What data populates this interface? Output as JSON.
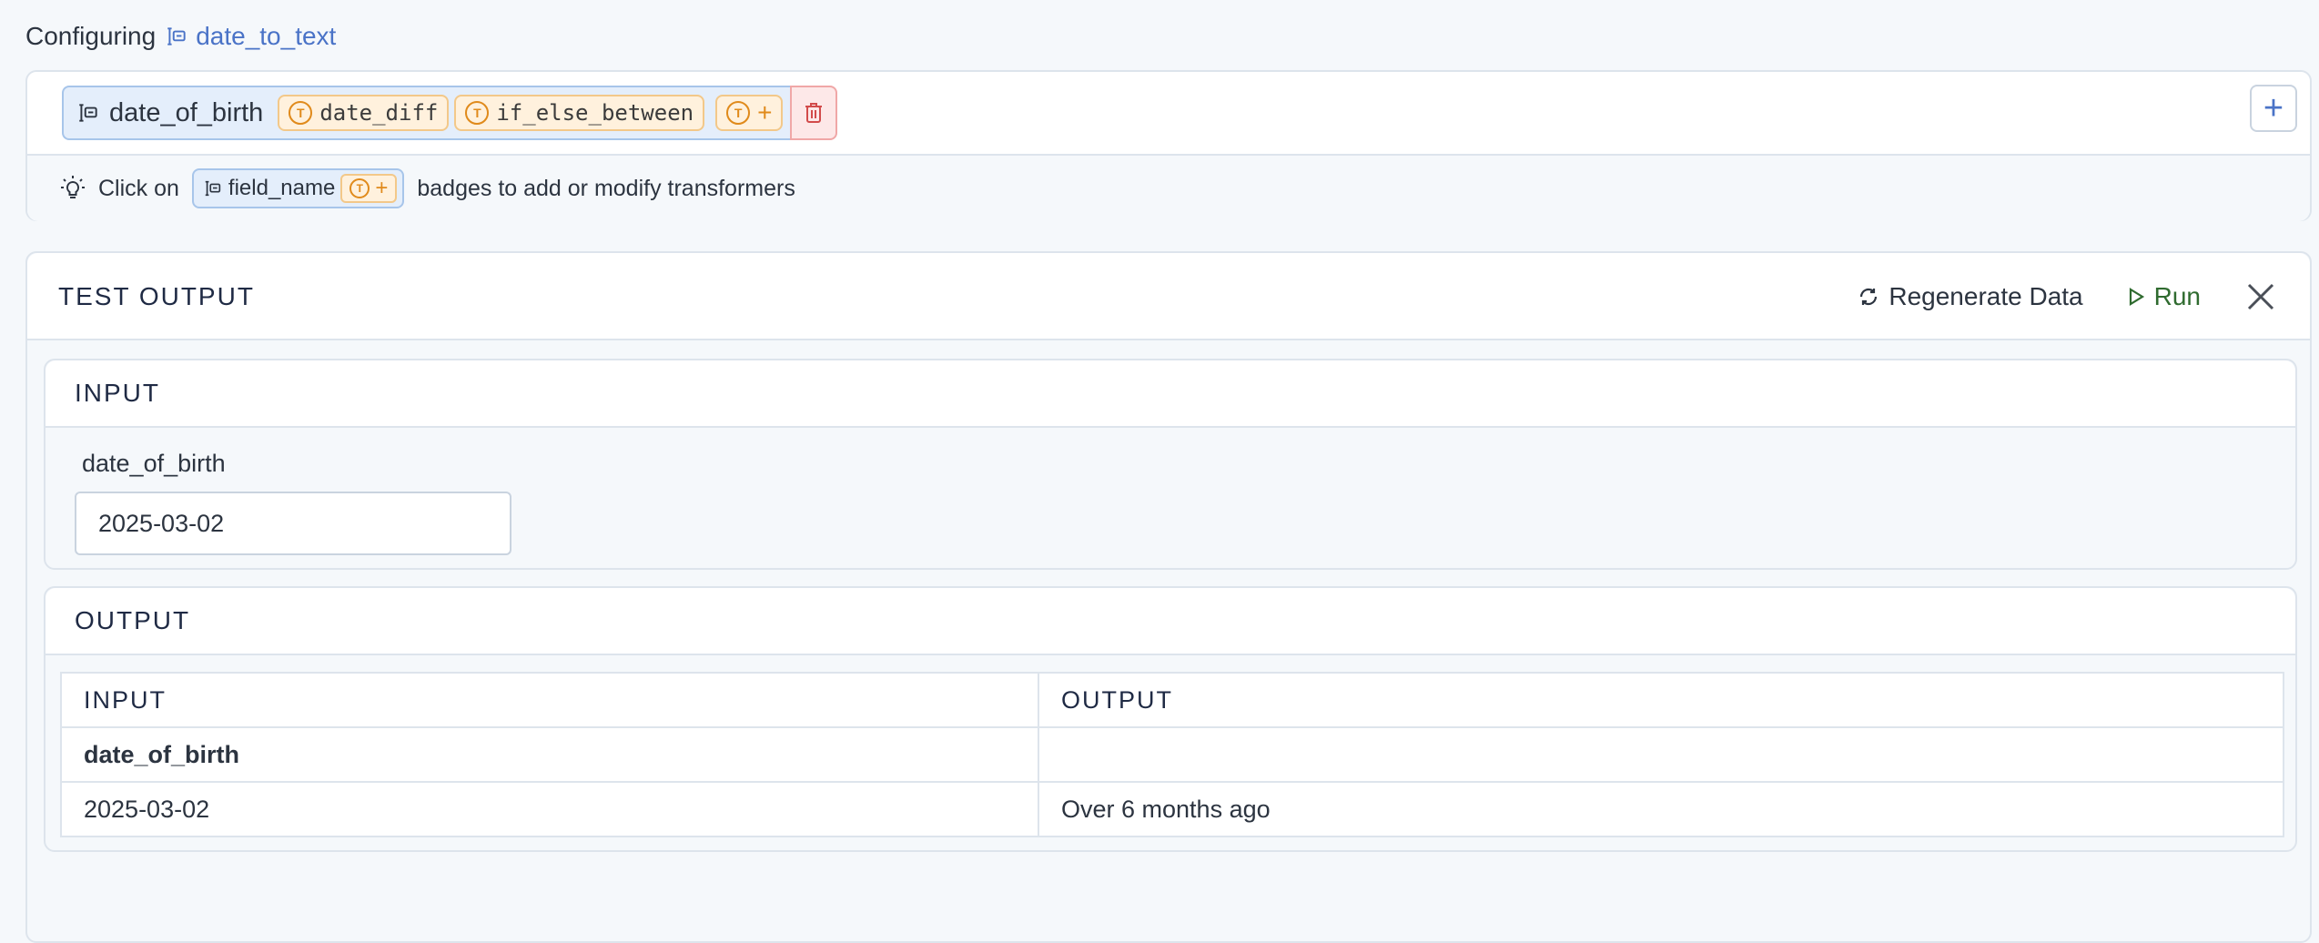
{
  "header": {
    "prefix": "Configuring",
    "field_name": "date_to_text"
  },
  "pipeline": {
    "field": "date_of_birth",
    "transformers": [
      "date_diff",
      "if_else_between"
    ]
  },
  "hint": {
    "lead": "Click on",
    "badge_field": "field_name",
    "trail": "badges to add or modify transformers"
  },
  "test_panel": {
    "title": "TEST OUTPUT",
    "regenerate_label": "Regenerate Data",
    "run_label": "Run"
  },
  "input_section": {
    "title": "INPUT",
    "field_label": "date_of_birth",
    "field_value": "2025-03-02"
  },
  "output_section": {
    "title": "OUTPUT",
    "columns": [
      "INPUT",
      "OUTPUT"
    ],
    "field_row": "date_of_birth",
    "rows": [
      {
        "input": "2025-03-02",
        "output": "Over 6 months ago"
      }
    ]
  },
  "colors": {
    "accent_blue": "#4a73c7",
    "transformer_orange": "#e08a1b",
    "run_green": "#2f6b2f",
    "delete_red": "#d24b4b"
  },
  "icons": [
    "field-icon",
    "transformer-icon",
    "plus-icon",
    "trash-icon",
    "lightbulb-icon",
    "refresh-icon",
    "play-icon",
    "close-icon"
  ]
}
